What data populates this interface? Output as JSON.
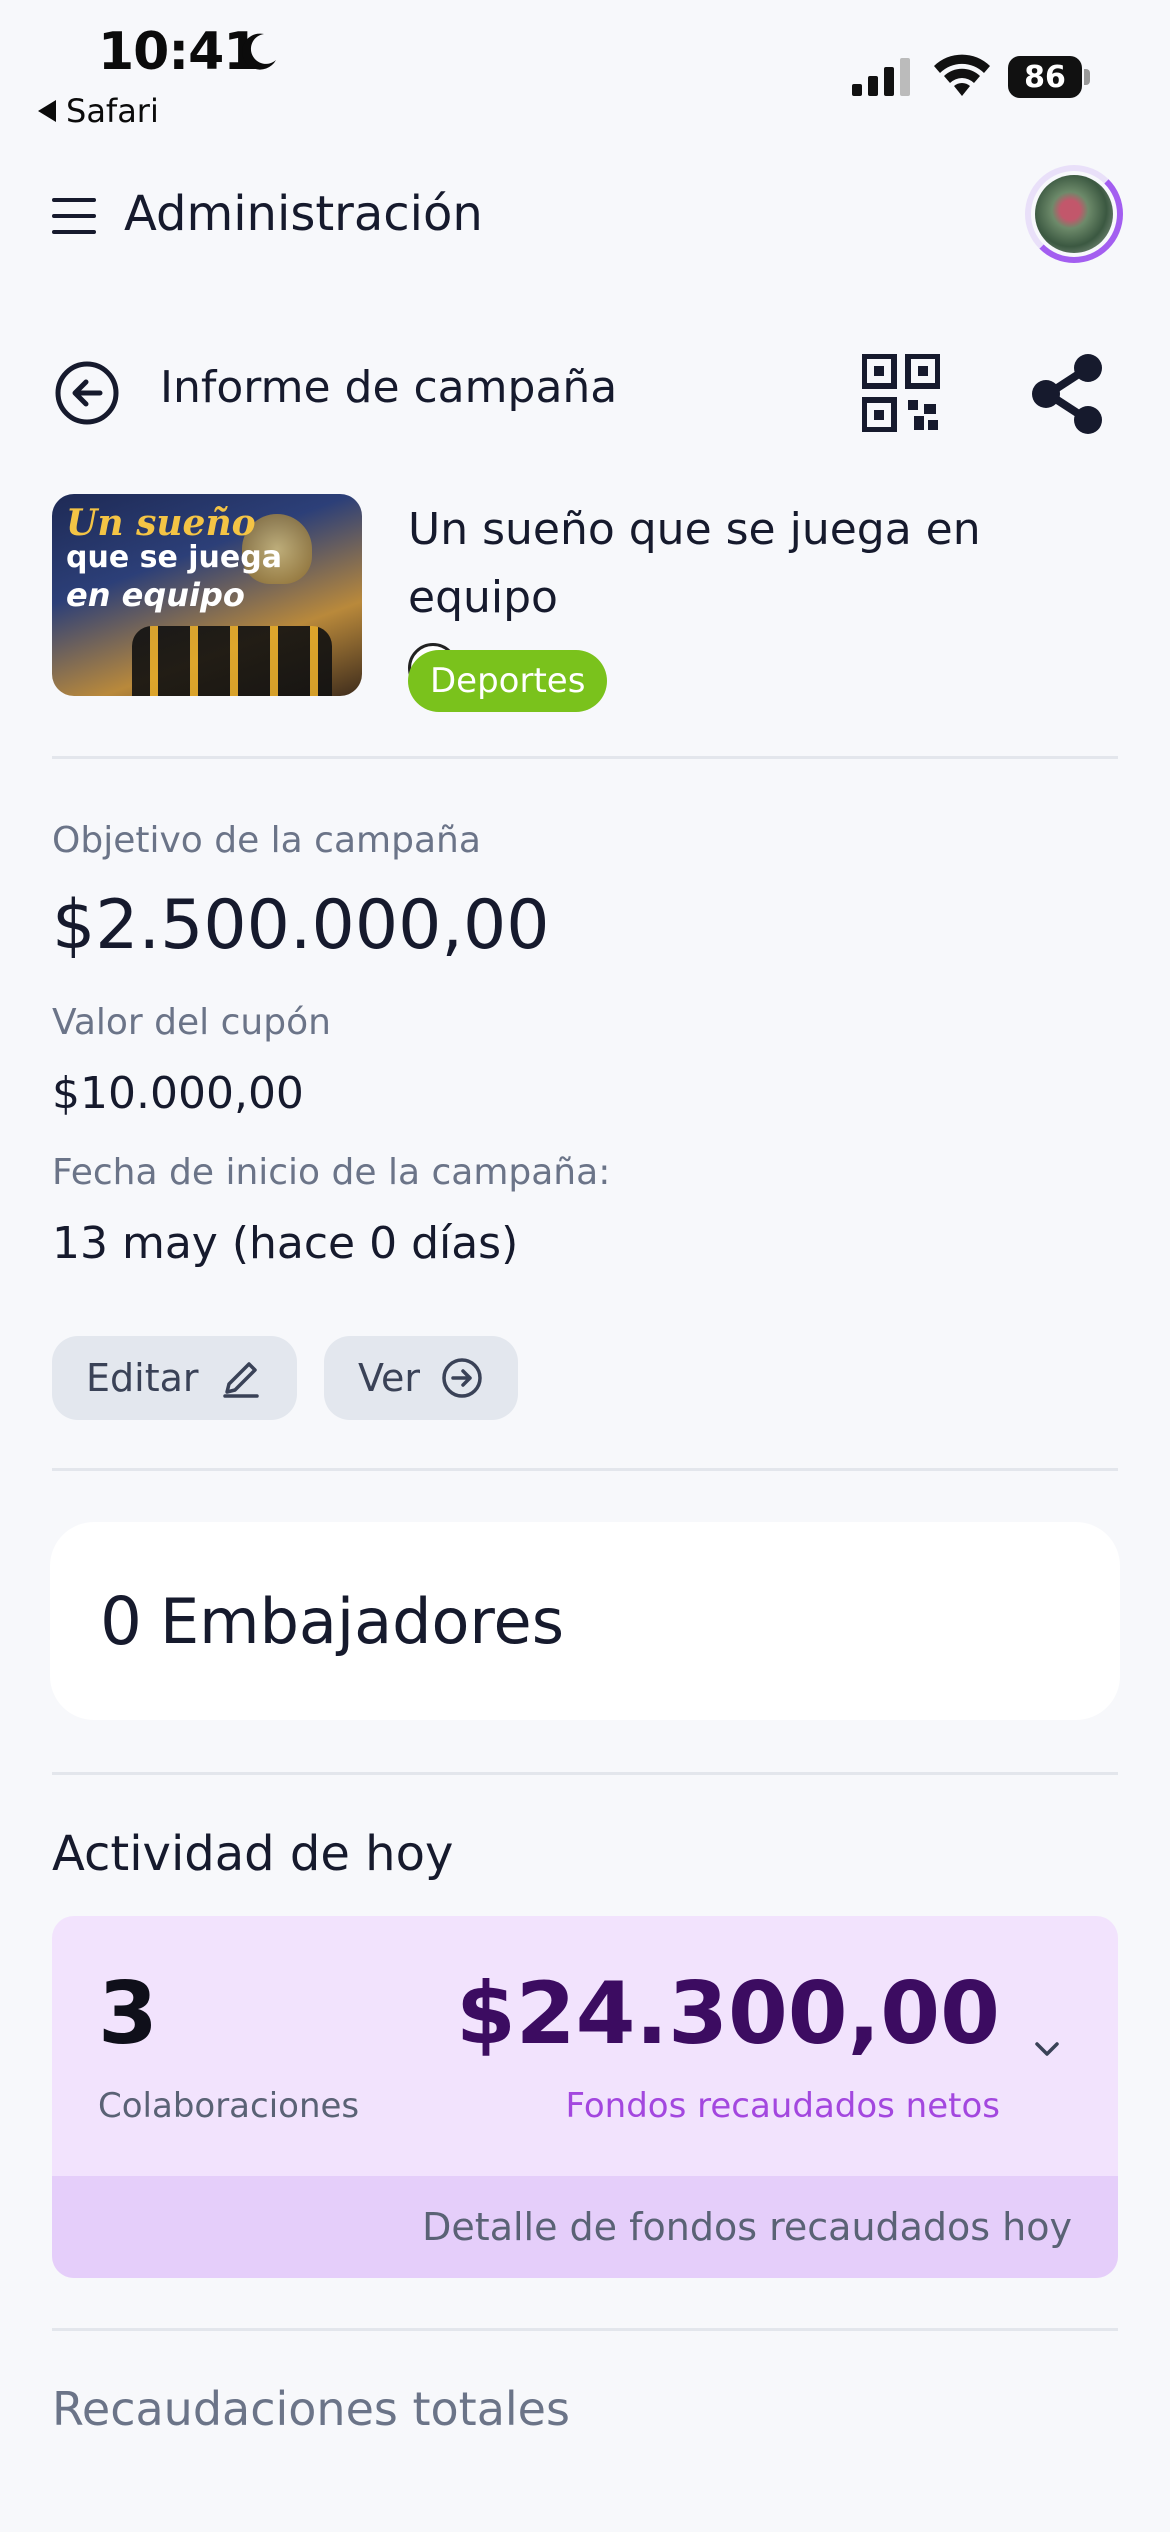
{
  "status_bar": {
    "time": "10:41",
    "back_app": "Safari",
    "battery": "86",
    "icons": [
      "moon-icon",
      "signal-icon",
      "wifi-icon",
      "battery-icon"
    ]
  },
  "header": {
    "title": "Administración",
    "menu_icon": "hamburger-menu-icon",
    "avatar": "user-avatar"
  },
  "subheader": {
    "title": "Informe de campaña",
    "icons": [
      "back-arrow-icon",
      "qr-code-icon",
      "share-icon"
    ]
  },
  "campaign": {
    "name": "Un sueño que se juega en equipo",
    "emoji_icon": "soccer-ball-icon",
    "category": "Deportes",
    "image_text": {
      "line1": "Un sueño",
      "line2": "que se juega",
      "line3": "en equipo"
    }
  },
  "details": {
    "goal_label": "Objetivo de la campaña",
    "goal_value": "$2.500.000,00",
    "coupon_label": "Valor del cupón",
    "coupon_value": "$10.000,00",
    "start_label": "Fecha de inicio de la campaña:",
    "start_value": "13 may (hace 0 días)"
  },
  "actions": {
    "edit_label": "Editar",
    "view_label": "Ver"
  },
  "ambassadors": {
    "count": "0",
    "label": "Embajadores"
  },
  "today": {
    "title": "Actividad de hoy",
    "collab_count": "3",
    "collab_label": "Colaboraciones",
    "amount": "$24.300,00",
    "amount_label": "Fondos recaudados netos",
    "detail_label": "Detalle de fondos recaudados hoy"
  },
  "totals": {
    "title": "Recaudaciones totales"
  },
  "colors": {
    "accent_purple": "#3c0c61",
    "accent_light_purple": "#a347df",
    "tag_green": "#7ac21c",
    "activity_bg": "#f2e3fd"
  }
}
